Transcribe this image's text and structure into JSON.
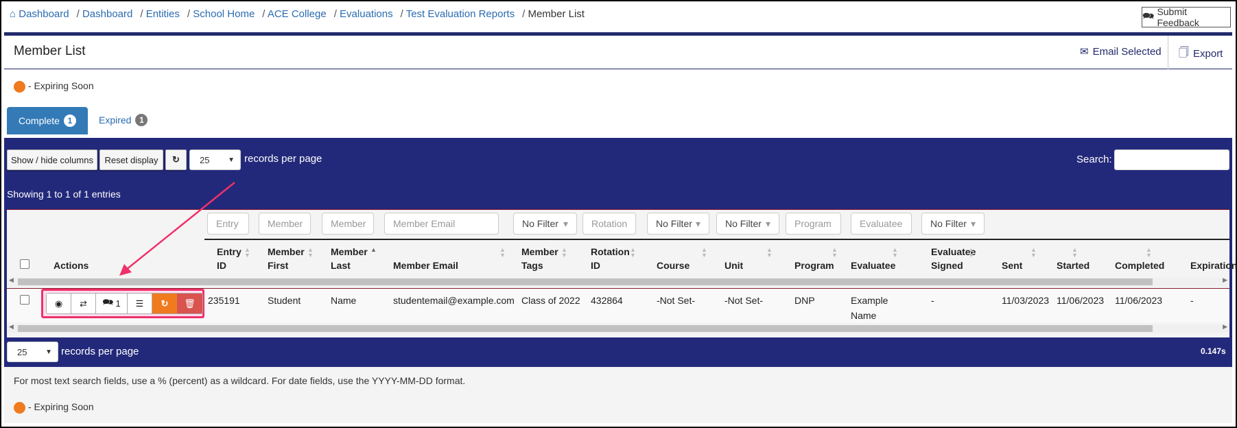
{
  "breadcrumb": [
    "Dashboard",
    "Dashboard",
    "Entities",
    "School Home",
    "ACE College",
    "Evaluations",
    "Test Evaluation Reports"
  ],
  "breadcrumb_current": "Member List",
  "feedback_label": "Submit Feedback",
  "page_title": "Member List",
  "header_actions": {
    "email": "Email Selected",
    "export": "Export"
  },
  "legend": {
    "expiring": "- Expiring Soon",
    "color": "#f07a1e"
  },
  "tabs": [
    {
      "label": "Complete",
      "count": "1",
      "active": true
    },
    {
      "label": "Expired",
      "count": "1",
      "active": false
    }
  ],
  "toolbar": {
    "show_hide": "Show / hide columns",
    "reset": "Reset display",
    "page_size": "25",
    "records_label": "records per page",
    "search_label": "Search:",
    "search_value": ""
  },
  "info": "Showing 1 to 1 of 1 entries",
  "filters": [
    "Entry",
    "Member",
    "Member",
    "Member Email",
    "No Filter",
    "Rotation",
    "No Filter",
    "No Filter",
    "Program",
    "Evaluatee",
    "No Filter"
  ],
  "columns": [
    [
      "Actions",
      ""
    ],
    [
      "Entry",
      "ID"
    ],
    [
      "Member",
      "First"
    ],
    [
      "Member",
      "Last"
    ],
    [
      "Member Email",
      ""
    ],
    [
      "Member",
      "Tags"
    ],
    [
      "Rotation",
      "ID"
    ],
    [
      "Course",
      ""
    ],
    [
      "Unit",
      ""
    ],
    [
      "Program",
      ""
    ],
    [
      "Evaluatee",
      ""
    ],
    [
      "Evaluatee",
      "Signed"
    ],
    [
      "Sent",
      ""
    ],
    [
      "Started",
      ""
    ],
    [
      "Completed",
      ""
    ],
    [
      "Expiration",
      ""
    ]
  ],
  "rows": [
    {
      "comment_count": "1",
      "cells": [
        "235191",
        "Student",
        "Name",
        "studentemail@example.com",
        "Class of 2022",
        "432864",
        "-Not Set-",
        "-Not Set-",
        "DNP",
        "Example Name",
        "-",
        "11/03/2023",
        "11/06/2023",
        "11/06/2023",
        "-"
      ]
    }
  ],
  "footer": {
    "page_size": "25",
    "records_label": "records per page",
    "timing": "0.147s"
  },
  "note": "For most text search fields, use a % (percent) as a wildcard. For date fields, use the YYYY-MM-DD format.",
  "colors": {
    "navy": "#23297a",
    "primary": "#337ab7",
    "warning": "#f07a1e",
    "danger": "#d9534f",
    "annotation": "#f0306a"
  }
}
